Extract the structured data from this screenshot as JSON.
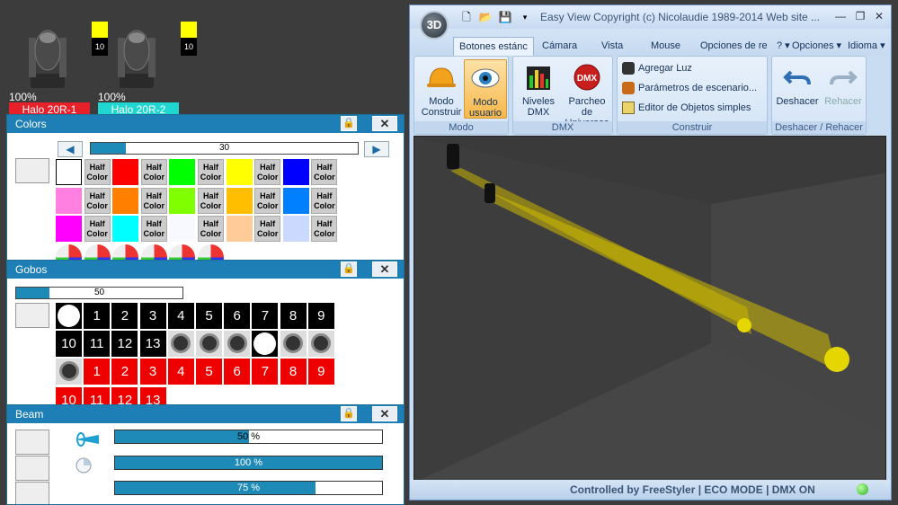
{
  "fixtures": [
    {
      "percent": "100%",
      "name": "Halo 20R-1",
      "name_color": "#e8202a",
      "value": "10"
    },
    {
      "percent": "100%",
      "name": "Halo 20R-2",
      "name_color": "#1fd6d0",
      "value": "10"
    }
  ],
  "colors_panel": {
    "title": "Colors",
    "slider_value": "30",
    "slider_fraction": 0.13,
    "prev_arrow": "◀",
    "next_arrow": "▶",
    "half_label_1": "Half",
    "half_label_2": "Color",
    "swatches": [
      "#ffffff",
      "#ff0000",
      "#00ff00",
      "#ffff00",
      "#0000ff",
      "#ff80e0",
      "#ff8000",
      "#80ff00",
      "#ffbf00",
      "#0080ff",
      "#ff00ff",
      "#00ffff",
      "#f8f8ff",
      "#ffcc99",
      "#ccd9ff"
    ]
  },
  "gobos_panel": {
    "title": "Gobos",
    "slider_value": "50",
    "slider_fraction": 0.2,
    "row1": [
      "",
      "1",
      "2",
      "3",
      "4",
      "5",
      "6",
      "7",
      "8",
      "9"
    ],
    "row2": [
      "10",
      "11",
      "12",
      "13"
    ],
    "row3": [
      "1",
      "2",
      "3",
      "4",
      "5",
      "6",
      "7",
      "8",
      "9"
    ],
    "row4": [
      "10",
      "11",
      "12",
      "13"
    ]
  },
  "beam_panel": {
    "title": "Beam",
    "bars": [
      {
        "label": "50 %",
        "fraction": 0.5
      },
      {
        "label": "100 %",
        "fraction": 1.0
      },
      {
        "label": "75 %",
        "fraction": 0.75
      }
    ]
  },
  "window": {
    "orb": "3D",
    "title": "Easy View   Copyright (c) Nicolaudie 1989-2014    Web site ...",
    "minimize": "—",
    "restore": "❐",
    "close": "✕",
    "tabs": [
      "Botones estánc",
      "Cámara",
      "Vista",
      "Mouse",
      "Opciones de re"
    ],
    "help": "?",
    "options": "Opciones",
    "language": "Idioma",
    "groups": {
      "modo": {
        "label": "Modo",
        "btn1": "Modo Construir",
        "btn2": "Modo usuario"
      },
      "dmx": {
        "label": "DMX",
        "btn1": "Niveles DMX",
        "btn2": "Parcheo de Universos"
      },
      "construir": {
        "label": "Construir",
        "item1": "Agregar Luz",
        "item2": "Parámetros de escenario...",
        "item3": "Editor de Objetos simples"
      },
      "undo": {
        "label": "Deshacer / Rehacer",
        "btn1": "Deshacer",
        "btn2": "Rehacer"
      }
    },
    "status": "Controlled by FreeStyler   |   ECO MODE   |   DMX ON"
  }
}
